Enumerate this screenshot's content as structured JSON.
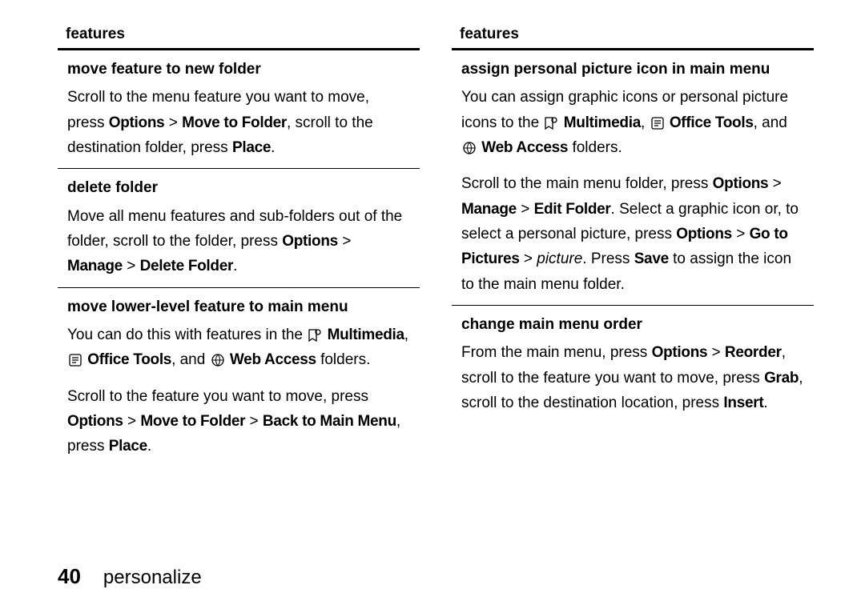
{
  "footer": {
    "page_number": "40",
    "section": "personalize"
  },
  "icons": {
    "multimedia": "Multimedia",
    "office_tools": "Office Tools",
    "web_access": "Web Access"
  },
  "left": {
    "header": "features",
    "rows": [
      {
        "title": "move feature to new folder",
        "body_parts": [
          {
            "t": "plain",
            "v": "Scroll to the menu feature you want to move, press "
          },
          {
            "t": "cond",
            "v": "Options"
          },
          {
            "t": "plain",
            "v": " > "
          },
          {
            "t": "cond",
            "v": "Move to Folder"
          },
          {
            "t": "plain",
            "v": ", scroll to the destination folder, press "
          },
          {
            "t": "cond",
            "v": "Place"
          },
          {
            "t": "plain",
            "v": "."
          }
        ]
      },
      {
        "title": "delete folder",
        "body_parts": [
          {
            "t": "plain",
            "v": "Move all menu features and sub-folders out of the folder, scroll to the folder, press "
          },
          {
            "t": "cond",
            "v": "Options"
          },
          {
            "t": "plain",
            "v": " > "
          },
          {
            "t": "cond",
            "v": "Manage"
          },
          {
            "t": "plain",
            "v": " > "
          },
          {
            "t": "cond",
            "v": "Delete Folder"
          },
          {
            "t": "plain",
            "v": "."
          }
        ]
      },
      {
        "title": "move lower-level feature to main menu",
        "body_parts": [
          {
            "t": "plain",
            "v": "You can do this with features in the "
          },
          {
            "t": "icon",
            "v": "multimedia"
          },
          {
            "t": "cond",
            "v": "Multimedia"
          },
          {
            "t": "plain",
            "v": ", "
          },
          {
            "t": "icon",
            "v": "office_tools"
          },
          {
            "t": "cond",
            "v": "Office Tools"
          },
          {
            "t": "plain",
            "v": ", and "
          },
          {
            "t": "icon",
            "v": "web_access"
          },
          {
            "t": "cond",
            "v": "Web Access"
          },
          {
            "t": "plain",
            "v": " folders."
          },
          {
            "t": "br"
          },
          {
            "t": "plain",
            "v": "Scroll to the feature you want to move, press "
          },
          {
            "t": "cond",
            "v": "Options"
          },
          {
            "t": "plain",
            "v": " > "
          },
          {
            "t": "cond",
            "v": "Move to Folder"
          },
          {
            "t": "plain",
            "v": " > "
          },
          {
            "t": "cond",
            "v": "Back to Main Menu"
          },
          {
            "t": "plain",
            "v": ", press "
          },
          {
            "t": "cond",
            "v": "Place"
          },
          {
            "t": "plain",
            "v": "."
          }
        ]
      }
    ]
  },
  "right": {
    "header": "features",
    "rows": [
      {
        "title": "assign personal picture icon in main menu",
        "body_parts": [
          {
            "t": "plain",
            "v": "You can assign graphic icons or personal picture icons to the "
          },
          {
            "t": "icon",
            "v": "multimedia"
          },
          {
            "t": "cond",
            "v": "Multimedia"
          },
          {
            "t": "plain",
            "v": ", "
          },
          {
            "t": "icon",
            "v": "office_tools"
          },
          {
            "t": "cond",
            "v": "Office Tools"
          },
          {
            "t": "plain",
            "v": ", and "
          },
          {
            "t": "icon",
            "v": "web_access"
          },
          {
            "t": "cond",
            "v": "Web Access"
          },
          {
            "t": "plain",
            "v": " folders."
          },
          {
            "t": "br"
          },
          {
            "t": "plain",
            "v": "Scroll to the main menu folder, press "
          },
          {
            "t": "cond",
            "v": "Options"
          },
          {
            "t": "plain",
            "v": " > "
          },
          {
            "t": "cond",
            "v": "Manage"
          },
          {
            "t": "plain",
            "v": " > "
          },
          {
            "t": "cond",
            "v": "Edit Folder"
          },
          {
            "t": "plain",
            "v": ". Select a graphic icon or, to select a personal picture, press "
          },
          {
            "t": "cond",
            "v": "Options"
          },
          {
            "t": "plain",
            "v": " > "
          },
          {
            "t": "cond",
            "v": "Go to Pictures"
          },
          {
            "t": "plain",
            "v": " > "
          },
          {
            "t": "italic",
            "v": "picture"
          },
          {
            "t": "plain",
            "v": ". Press "
          },
          {
            "t": "cond",
            "v": "Save"
          },
          {
            "t": "plain",
            "v": " to assign the icon to the main menu folder."
          }
        ]
      },
      {
        "title": "change main menu order",
        "body_parts": [
          {
            "t": "plain",
            "v": "From the main menu, press "
          },
          {
            "t": "cond",
            "v": "Options"
          },
          {
            "t": "plain",
            "v": " > "
          },
          {
            "t": "cond",
            "v": "Reorder"
          },
          {
            "t": "plain",
            "v": ", scroll to the feature you want to move, press "
          },
          {
            "t": "cond",
            "v": "Grab"
          },
          {
            "t": "plain",
            "v": ", scroll to the destination location, press "
          },
          {
            "t": "cond",
            "v": "Insert"
          },
          {
            "t": "plain",
            "v": "."
          }
        ]
      }
    ]
  }
}
